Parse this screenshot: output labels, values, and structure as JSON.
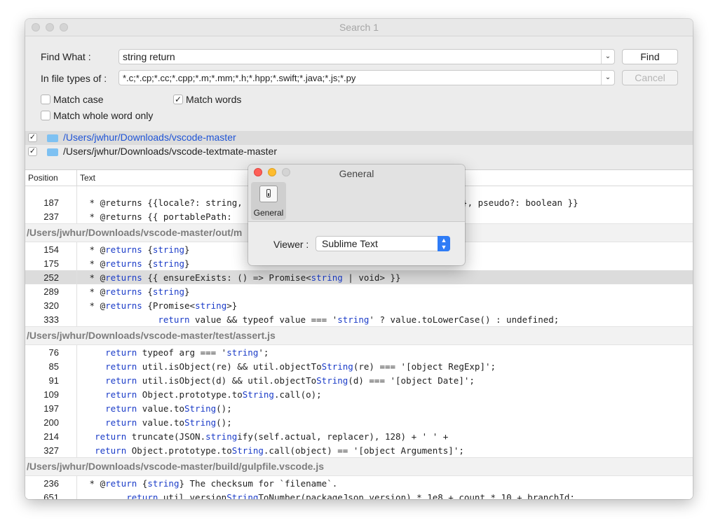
{
  "window": {
    "title": "Search 1"
  },
  "form": {
    "find_label": "Find What :",
    "find_value": "string return",
    "types_label": "In file types of :",
    "types_value": "*.c;*.cp;*.cc;*.cpp;*.m;*.mm;*.h;*.hpp;*.swift;*.java;*.js;*.py",
    "find_button": "Find",
    "cancel_button": "Cancel",
    "match_case": {
      "label": "Match case",
      "checked": false
    },
    "match_words": {
      "label": "Match words",
      "checked": true
    },
    "match_whole": {
      "label": "Match whole word only",
      "checked": false
    }
  },
  "folders": [
    {
      "path": "/Users/jwhur/Downloads/vscode-master",
      "checked": true,
      "selected": true
    },
    {
      "path": "/Users/jwhur/Downloads/vscode-textmate-master",
      "checked": true,
      "selected": false
    }
  ],
  "results": {
    "col_position": "Position",
    "col_text": "Text",
    "rows": [
      {
        "pos": "187",
        "text": " * @returns {{locale?: string, a",
        "tail": "g;}, pseudo?: boolean }}"
      },
      {
        "pos": "237",
        "text": " * @returns {{ portablePath: "
      }
    ],
    "group2": "/Users/jwhur/Downloads/vscode-master/out/m",
    "rows2": [
      {
        "pos": "154",
        "text": " * @returns {string}"
      },
      {
        "pos": "175",
        "text": " * @returns {string}"
      },
      {
        "pos": "252",
        "text": " * @returns {{ ensureExists: () => Promise<string | void> }}"
      },
      {
        "pos": "289",
        "text": " * @returns {string}"
      },
      {
        "pos": "320",
        "text": " * @returns {Promise<string>}"
      },
      {
        "pos": "333",
        "text": "              return value && typeof value === 'string' ? value.toLowerCase() : undefined;"
      }
    ],
    "group3": "/Users/jwhur/Downloads/vscode-master/test/assert.js",
    "rows3": [
      {
        "pos": "76",
        "text": "    return typeof arg === 'string';"
      },
      {
        "pos": "85",
        "text": "    return util.isObject(re) && util.objectToString(re) === '[object RegExp]';"
      },
      {
        "pos": "91",
        "text": "    return util.isObject(d) && util.objectToString(d) === '[object Date]';"
      },
      {
        "pos": "109",
        "text": "    return Object.prototype.toString.call(o);"
      },
      {
        "pos": "197",
        "text": "    return value.toString();"
      },
      {
        "pos": "200",
        "text": "    return value.toString();"
      },
      {
        "pos": "214",
        "text": "  return truncate(JSON.stringify(self.actual, replacer), 128) + ' ' +"
      },
      {
        "pos": "327",
        "text": "  return Object.prototype.toString.call(object) == '[object Arguments]';"
      }
    ],
    "group4": "/Users/jwhur/Downloads/vscode-master/build/gulpfile.vscode.js",
    "rows4": [
      {
        "pos": "236",
        "text": " * @return {string} The checksum for `filename`."
      },
      {
        "pos": "651",
        "text": "        return util.versionStringToNumber(packageJson.version) * 1e8 + count * 10 + branchId;"
      }
    ]
  },
  "dialog": {
    "title": "General",
    "toolbar_label": "General",
    "viewer_label": "Viewer :",
    "viewer_value": "Sublime Text"
  },
  "colors": {
    "keyword": "#1b3cc8",
    "close": "#fe5f57",
    "minimize": "#febc2e",
    "selection": "#dcdcdc"
  }
}
